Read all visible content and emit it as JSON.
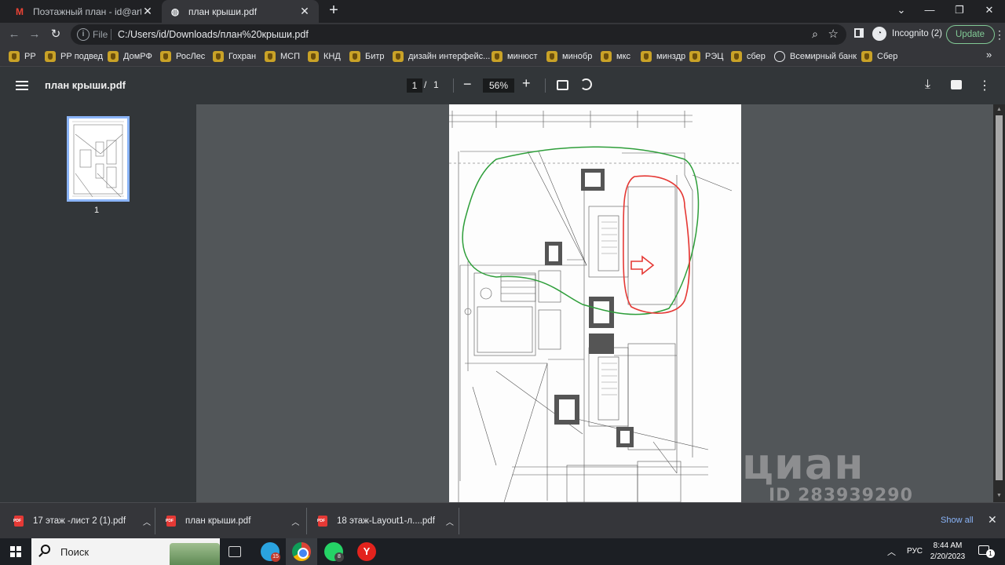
{
  "tabs": [
    {
      "title": "Поэтажный план - id@artwell.ru",
      "favicon": "gmail-icon",
      "active": false
    },
    {
      "title": "план крыши.pdf",
      "favicon": "globe-icon",
      "active": true
    }
  ],
  "toolbar": {
    "url_scheme": "File",
    "url": "C:/Users/id/Downloads/план%20крыши.pdf",
    "profile_label": "Incognito (2)",
    "update_label": "Update"
  },
  "bookmarks": [
    {
      "label": "РР",
      "icon": "emblem-icon"
    },
    {
      "label": "РР подвед",
      "icon": "emblem-icon"
    },
    {
      "label": "ДомРФ",
      "icon": "emblem-icon"
    },
    {
      "label": "РосЛес",
      "icon": "emblem-icon"
    },
    {
      "label": "Гохран",
      "icon": "emblem-icon"
    },
    {
      "label": "МСП",
      "icon": "emblem-icon"
    },
    {
      "label": "КНД",
      "icon": "emblem-icon"
    },
    {
      "label": "Битр",
      "icon": "emblem-icon"
    },
    {
      "label": "дизайн интерфейс...",
      "icon": "emblem-icon"
    },
    {
      "label": "минюст",
      "icon": "emblem-icon"
    },
    {
      "label": "минобр",
      "icon": "emblem-icon"
    },
    {
      "label": "мкс",
      "icon": "emblem-icon"
    },
    {
      "label": "минздр",
      "icon": "emblem-icon"
    },
    {
      "label": "РЭЦ",
      "icon": "emblem-icon"
    },
    {
      "label": "сбер",
      "icon": "emblem-icon"
    },
    {
      "label": "Всемирный банк",
      "icon": "globe-icon"
    },
    {
      "label": "Сбер",
      "icon": "emblem-icon"
    }
  ],
  "viewer": {
    "title": "план крыши.pdf",
    "page_current": "1",
    "page_separator": "/",
    "page_total": "1",
    "zoom": "56%",
    "thumbnail_label": "1"
  },
  "watermark": {
    "brand": "циан",
    "id": "ID 283939290"
  },
  "downloads": [
    {
      "name": "17 этаж -лист 2 (1).pdf"
    },
    {
      "name": "план крыши.pdf"
    },
    {
      "name": "18 этаж-Layout1-л....pdf"
    }
  ],
  "downloads_show_all": "Show all",
  "taskbar": {
    "search_placeholder": "Поиск",
    "telegram_badge": "15",
    "whatsapp_badge": "8",
    "language": "РУС",
    "time": "8:44 AM",
    "date": "2/20/2023",
    "notifications": "1"
  },
  "colors": {
    "accent": "#8ab4f8",
    "update_green": "#81c995",
    "markup_red": "#e53935",
    "markup_green": "#2e9e3a"
  }
}
